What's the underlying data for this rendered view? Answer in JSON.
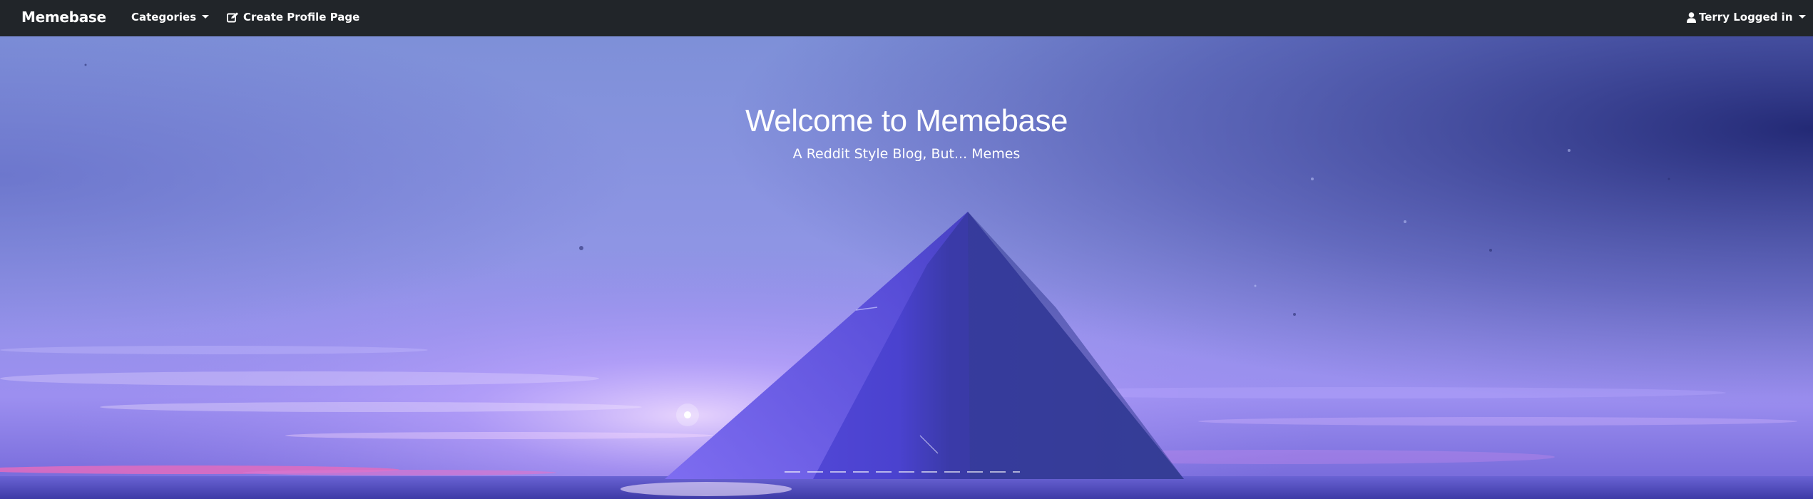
{
  "navbar": {
    "brand": "Memebase",
    "categories_label": "Categories",
    "create_profile_label": "Create Profile Page",
    "user_label": "Terry Logged in"
  },
  "hero": {
    "title": "Welcome to Memebase",
    "subtitle": "A Reddit Style Blog, But... Memes"
  },
  "colors": {
    "navbar_bg": "#212529",
    "hero_sky_top": "#7b8fdc",
    "hero_sky_glow": "#b39cf5",
    "pyramid": "#3b3cc4",
    "horizon_pink": "#e86ab4"
  },
  "icons": {
    "categories_caret": "caret-down-icon",
    "create_profile": "edit-icon",
    "user": "user-icon",
    "user_caret": "caret-down-icon"
  }
}
